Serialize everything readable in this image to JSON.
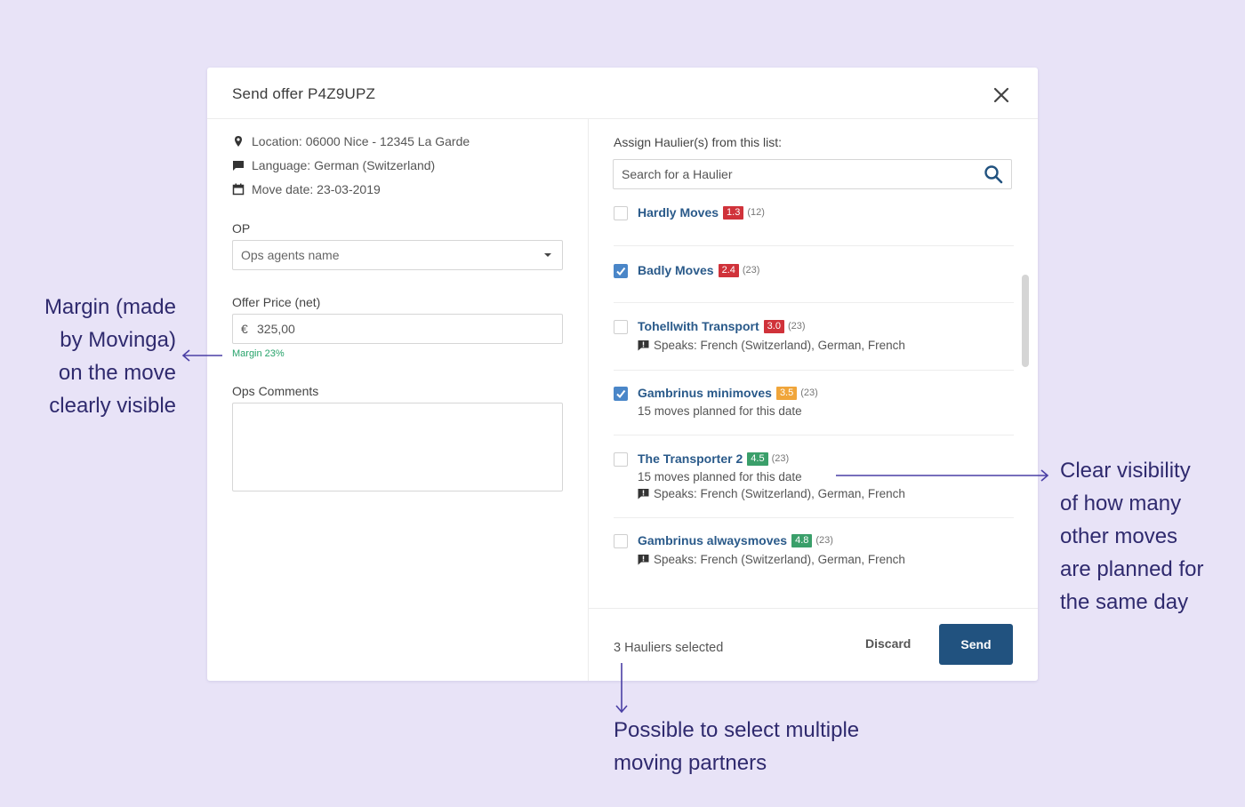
{
  "modal": {
    "title": "Send offer P4Z9UPZ",
    "close_icon": "close-icon"
  },
  "move_info": {
    "location": "Location: 06000 Nice - 12345 La Garde",
    "language": "Language: German (Switzerland)",
    "move_date": "Move date: 23-03-2019"
  },
  "form": {
    "op_label": "OP",
    "op_value": "Ops agents name",
    "offer_price_label": "Offer Price (net)",
    "currency_symbol": "€",
    "offer_price_value": "325,00",
    "margin_text": "Margin 23%",
    "ops_comments_label": "Ops Comments",
    "ops_comments_value": ""
  },
  "hauliers": {
    "assign_label": "Assign Haulier(s) from this list:",
    "search_placeholder": "Search for a Haulier",
    "items": [
      {
        "name": "Hardly Moves",
        "rating": "1.3",
        "count": "(12)",
        "checked": false,
        "moves_planned": "",
        "speaks": ""
      },
      {
        "name": "Badly Moves",
        "rating": "2.4",
        "count": "(23)",
        "checked": true,
        "moves_planned": "",
        "speaks": ""
      },
      {
        "name": "Tohellwith Transport",
        "rating": "3.0",
        "count": "(23)",
        "checked": false,
        "moves_planned": "",
        "speaks": "Speaks: French (Switzerland), German, French"
      },
      {
        "name": "Gambrinus minimoves",
        "rating": "3.5",
        "count": "(23)",
        "checked": true,
        "moves_planned": "15 moves planned for this date",
        "speaks": ""
      },
      {
        "name": "The Transporter 2",
        "rating": "4.5",
        "count": "(23)",
        "checked": false,
        "moves_planned": "15 moves planned for this date",
        "speaks": "Speaks: French (Switzerland), German, French"
      },
      {
        "name": "Gambrinus alwaysmoves",
        "rating": "4.8",
        "count": "(23)",
        "checked": false,
        "moves_planned": "",
        "speaks": "Speaks: French (Switzerland), German, French"
      }
    ]
  },
  "footer": {
    "selected_count": "3 Hauliers selected",
    "discard_label": "Discard",
    "send_label": "Send"
  },
  "annotations": {
    "margin_note": [
      "Margin (made",
      "by Movinga)",
      "on the move",
      "clearly visible"
    ],
    "visibility_note": [
      "Clear visibility",
      "of how many",
      "other moves",
      "are planned for",
      "the same day"
    ],
    "multiple_note": [
      "Possible to select multiple",
      "moving partners"
    ]
  },
  "colors": {
    "background": "#e8e3f7",
    "accent": "#21527f",
    "link": "#2a5a8a",
    "checkbox_checked": "#4a86c8",
    "margin_green": "#27a36b",
    "rating_red": "#d0323a",
    "rating_orange": "#f0a53a",
    "rating_green": "#3a9f6a",
    "annotation": "#2f2a6e"
  }
}
